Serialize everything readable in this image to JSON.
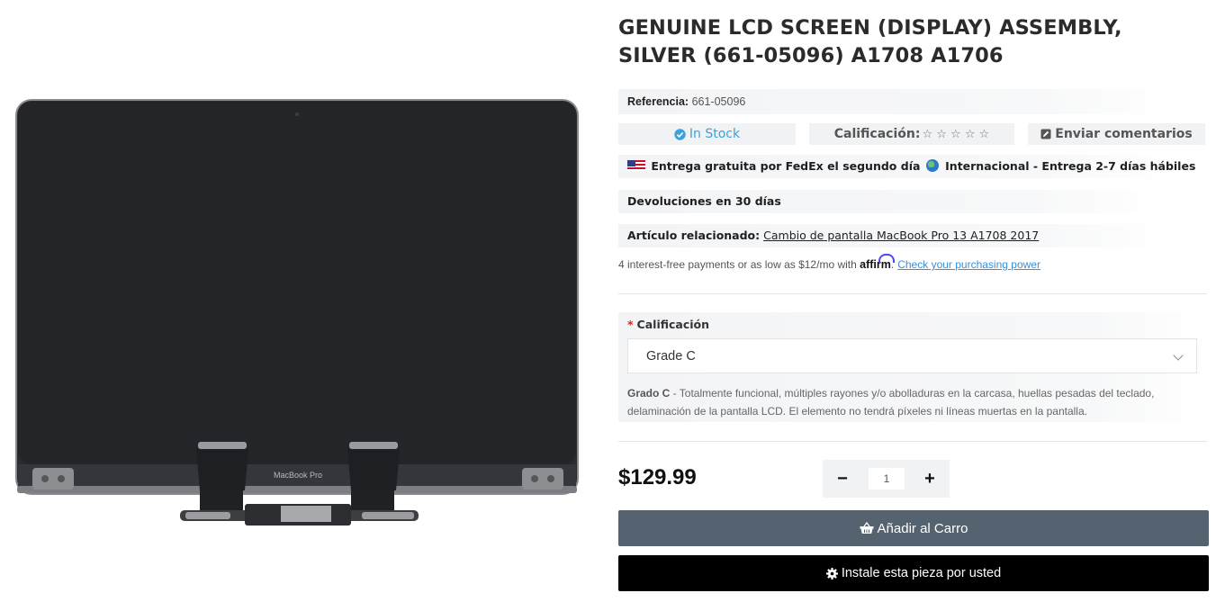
{
  "product": {
    "title": "GENUINE LCD SCREEN (DISPLAY) ASSEMBLY, SILVER (661-05096) A1708 A1706",
    "image_caption": "MacBook Pro",
    "reference_label": "Referencia:",
    "reference_value": "661-05096",
    "stock": "In Stock",
    "rating_label": "Calificación:",
    "rating_stars": "☆ ☆ ☆ ☆ ☆",
    "feedback_label": "Enviar comentarios",
    "shipping_text": "Entrega gratuita por FedEx el segundo día",
    "international_text": "Internacional - Entrega 2-7 días hábiles",
    "returns_text": "Devoluciones en 30 días",
    "related_label": "Artículo relacionado:",
    "related_link": "Cambio de pantalla MacBook Pro 13 A1708 2017",
    "affirm_text": "4 interest-free payments or as low as $12/mo with",
    "affirm_brand": "affirm",
    "affirm_link": "Check your purchasing power"
  },
  "option": {
    "required_mark": "*",
    "label": "Calificación",
    "selected": "Grade C",
    "desc_title": "Grado C",
    "desc_text": " - Totalmente funcional, múltiples rayones y/o abolladuras en la carcasa, huellas pesadas del teclado, delaminación de la pantalla LCD. El elemento no tendrá píxeles ni líneas muertas en la pantalla."
  },
  "purchase": {
    "price": "$129.99",
    "minus": "−",
    "plus": "+",
    "quantity": "1",
    "add_to_cart": "Añadir al Carro",
    "install": "Instale esta pieza por usted"
  },
  "colors": {
    "stock": "#3ba3d9",
    "cart_button": "#556370",
    "install_button": "#000000",
    "affirm_link": "#3a8fd6",
    "required": "#d9261c"
  }
}
